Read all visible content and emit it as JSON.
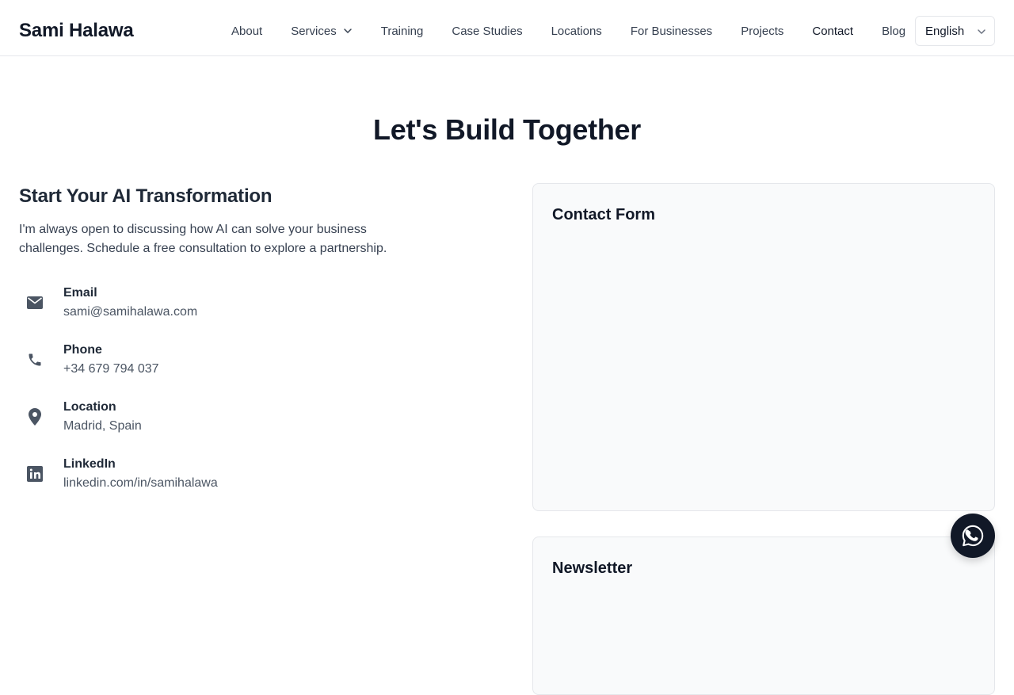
{
  "header": {
    "brand": "Sami Halawa",
    "nav": [
      {
        "label": "About",
        "name": "nav-about"
      },
      {
        "label": "Services",
        "name": "nav-services",
        "has_dropdown": true
      },
      {
        "label": "Training",
        "name": "nav-training"
      },
      {
        "label": "Case Studies",
        "name": "nav-case-studies"
      },
      {
        "label": "Locations",
        "name": "nav-locations"
      },
      {
        "label": "For Businesses",
        "name": "nav-for-businesses"
      },
      {
        "label": "Projects",
        "name": "nav-projects"
      },
      {
        "label": "Contact",
        "name": "nav-contact",
        "active": true
      },
      {
        "label": "Blog",
        "name": "nav-blog"
      }
    ],
    "language": {
      "selected": "English",
      "icon": "chevron-down-icon"
    }
  },
  "hero": {
    "title": "Let's Build Together"
  },
  "intro": {
    "title": "Start Your AI Transformation",
    "description": "I'm always open to discussing how AI can solve your business challenges. Schedule a free consultation to explore a partnership."
  },
  "contacts": [
    {
      "label": "Email",
      "value": "sami@samihalawa.com",
      "icon": "envelope-icon"
    },
    {
      "label": "Phone",
      "value": "+34 679 794 037",
      "icon": "phone-icon"
    },
    {
      "label": "Location",
      "value": "Madrid, Spain",
      "icon": "map-pin-icon"
    },
    {
      "label": "LinkedIn",
      "value": "linkedin.com/in/samihalawa",
      "icon": "linkedin-icon"
    }
  ],
  "form_card": {
    "title": "Contact Form"
  },
  "newsletter_card": {
    "title": "Newsletter"
  },
  "floating": {
    "icon": "whatsapp-icon"
  },
  "colors": {
    "text_primary": "#111827",
    "text_secondary": "#4b5563",
    "icon_gray": "#4b5563",
    "card_bg": "#f9fafb",
    "border": "#e5e7eb",
    "fab_bg": "#111827"
  }
}
